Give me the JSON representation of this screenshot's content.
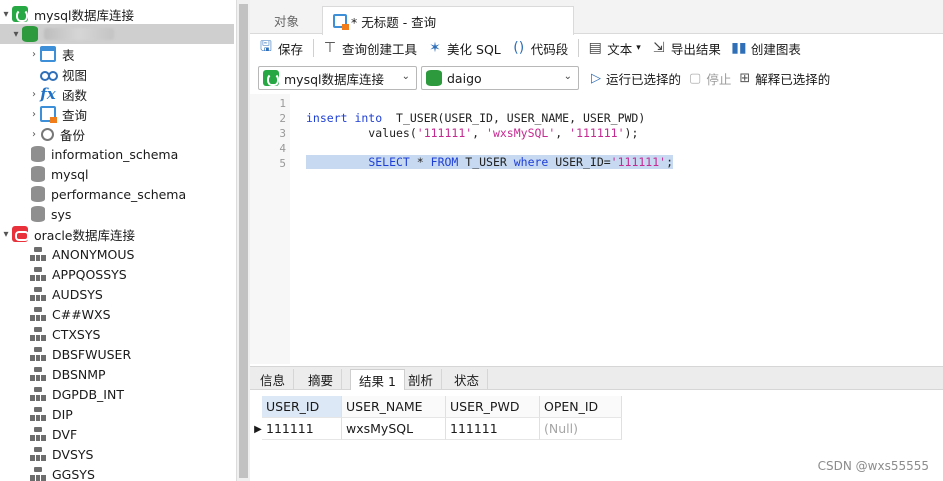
{
  "tree": {
    "mysql_connection": "mysql数据库连接",
    "mysql_children": [
      "表",
      "视图",
      "函数",
      "查询",
      "备份"
    ],
    "mysql_databases": [
      "information_schema",
      "mysql",
      "performance_schema",
      "sys"
    ],
    "oracle_connection": "oracle数据库连接",
    "oracle_users": [
      "ANONYMOUS",
      "APPQOSSYS",
      "AUDSYS",
      "C##WXS",
      "CTXSYS",
      "DBSFWUSER",
      "DBSNMP",
      "DGPDB_INT",
      "DIP",
      "DVF",
      "DVSYS",
      "GGSYS"
    ]
  },
  "tabs": {
    "objects": "对象",
    "query_tab": "* 无标题 - 查询"
  },
  "toolbar": {
    "save": "保存",
    "query_builder": "查询创建工具",
    "beautify": "美化 SQL",
    "snippet": "代码段",
    "text": "文本",
    "export": "导出结果",
    "chart": "创建图表"
  },
  "selectors": {
    "connection": "mysql数据库连接",
    "database": "daigo",
    "run_selected": "运行已选择的",
    "stop": "停止",
    "explain": "解释已选择的"
  },
  "editor": {
    "line_numbers": [
      "1",
      "2",
      "3",
      "4",
      "5"
    ]
  },
  "results": {
    "tabs": [
      "信息",
      "摘要",
      "结果 1",
      "剖析",
      "状态"
    ],
    "columns": [
      "USER_ID",
      "USER_NAME",
      "USER_PWD",
      "OPEN_ID"
    ],
    "rows": [
      [
        "111111",
        "wxsMySQL",
        "111111",
        "(Null)"
      ]
    ]
  },
  "watermark": "CSDN @wxs55555",
  "colors": {
    "selection": "#c6d9f0",
    "keyword": "#1e3fd6",
    "string": "#c42a92",
    "accent": "#27a844"
  }
}
